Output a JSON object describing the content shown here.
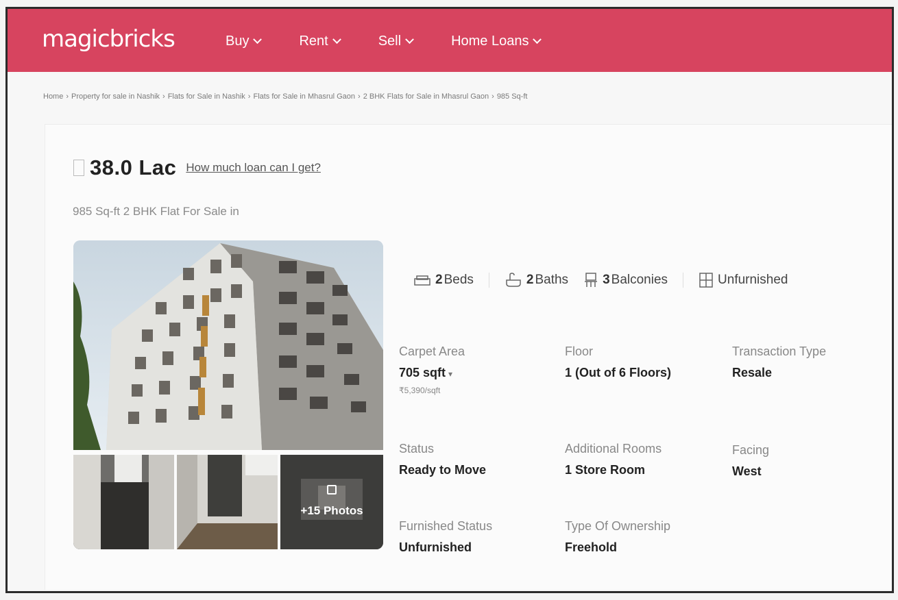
{
  "brand": {
    "logo": "magicbricks",
    "color": "#d7445f"
  },
  "nav": [
    {
      "label": "Buy"
    },
    {
      "label": "Rent"
    },
    {
      "label": "Sell"
    },
    {
      "label": "Home Loans"
    }
  ],
  "breadcrumb": [
    "Home",
    "Property for sale in Nashik",
    "Flats for Sale in Nashik",
    "Flats for Sale in Mhasrul Gaon",
    "2 BHK Flats for Sale in Mhasrul Gaon",
    "985 Sq-ft"
  ],
  "listing": {
    "price": "38.0 Lac",
    "loan_link": "How much loan can I get?",
    "title": "985 Sq-ft 2 BHK Flat For Sale in",
    "more_photos": "+15 Photos",
    "amenities": {
      "beds_count": "2",
      "beds_label": "Beds",
      "baths_count": "2",
      "baths_label": "Baths",
      "balconies_count": "3",
      "balconies_label": "Balconies",
      "furnishing": "Unfurnished"
    },
    "summary": {
      "carpet_area_label": "Carpet Area",
      "carpet_area_value": "705 sqft",
      "carpet_area_rate": "5,390/sqft",
      "floor_label": "Floor",
      "floor_value": "1 (Out of 6 Floors)",
      "transaction_label": "Transaction Type",
      "transaction_value": "Resale",
      "status_label": "Status",
      "status_value": "Ready to Move",
      "rooms_label": "Additional Rooms",
      "rooms_value": "1 Store Room",
      "facing_label": "Facing",
      "facing_value": "West",
      "furnished_label": "Furnished Status",
      "furnished_value": "Unfurnished",
      "ownership_label": "Type Of Ownership",
      "ownership_value": "Freehold"
    }
  }
}
